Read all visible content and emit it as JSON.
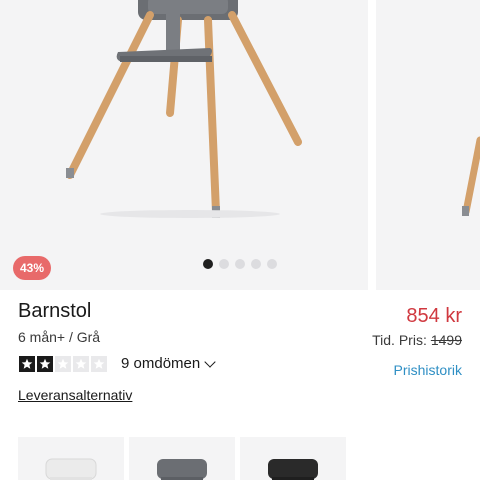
{
  "gallery": {
    "discount_badge": "43%",
    "dots": [
      true,
      false,
      false,
      false,
      false
    ]
  },
  "product": {
    "title": "Barnstol",
    "subtitle": "6 mån+ / Grå",
    "rating": 2,
    "rating_max": 5,
    "reviews_label": "9 omdömen",
    "delivery_label": "Leveransalternativ"
  },
  "pricing": {
    "price": "854 kr",
    "previous_label": "Tid. Pris:",
    "previous_value": "1499",
    "history_label": "Prishistorik",
    "price_color": "#d0383f",
    "link_color": "#2f8fc4"
  },
  "variants": [
    {
      "color_name": "white",
      "swatch": "#f2f2f2"
    },
    {
      "color_name": "grey",
      "swatch": "#6b6e73"
    },
    {
      "color_name": "black",
      "swatch": "#2a2a2a"
    }
  ]
}
